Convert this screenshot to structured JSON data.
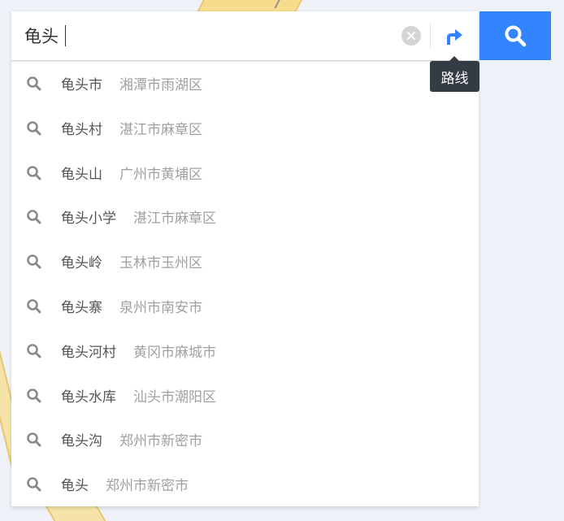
{
  "search": {
    "value": "龟头",
    "clear_icon": "clear-circle-icon",
    "route_icon": "route-turn-icon",
    "route_tooltip": "路线",
    "search_icon": "magnifier-icon"
  },
  "colors": {
    "accent": "#3385ff",
    "tooltip_bg": "#333c45",
    "name_text": "#555555",
    "area_text": "#a0a0a0"
  },
  "suggestions": [
    {
      "name": "龟头市",
      "area": "湘潭市雨湖区"
    },
    {
      "name": "龟头村",
      "area": "湛江市麻章区"
    },
    {
      "name": "龟头山",
      "area": "广州市黄埔区"
    },
    {
      "name": "龟头小学",
      "area": "湛江市麻章区"
    },
    {
      "name": "龟头岭",
      "area": "玉林市玉州区"
    },
    {
      "name": "龟头寨",
      "area": "泉州市南安市"
    },
    {
      "name": "龟头河村",
      "area": "黄冈市麻城市"
    },
    {
      "name": "龟头水库",
      "area": "汕头市潮阳区"
    },
    {
      "name": "龟头沟",
      "area": "郑州市新密市"
    },
    {
      "name": "龟头",
      "area": "郑州市新密市"
    }
  ]
}
